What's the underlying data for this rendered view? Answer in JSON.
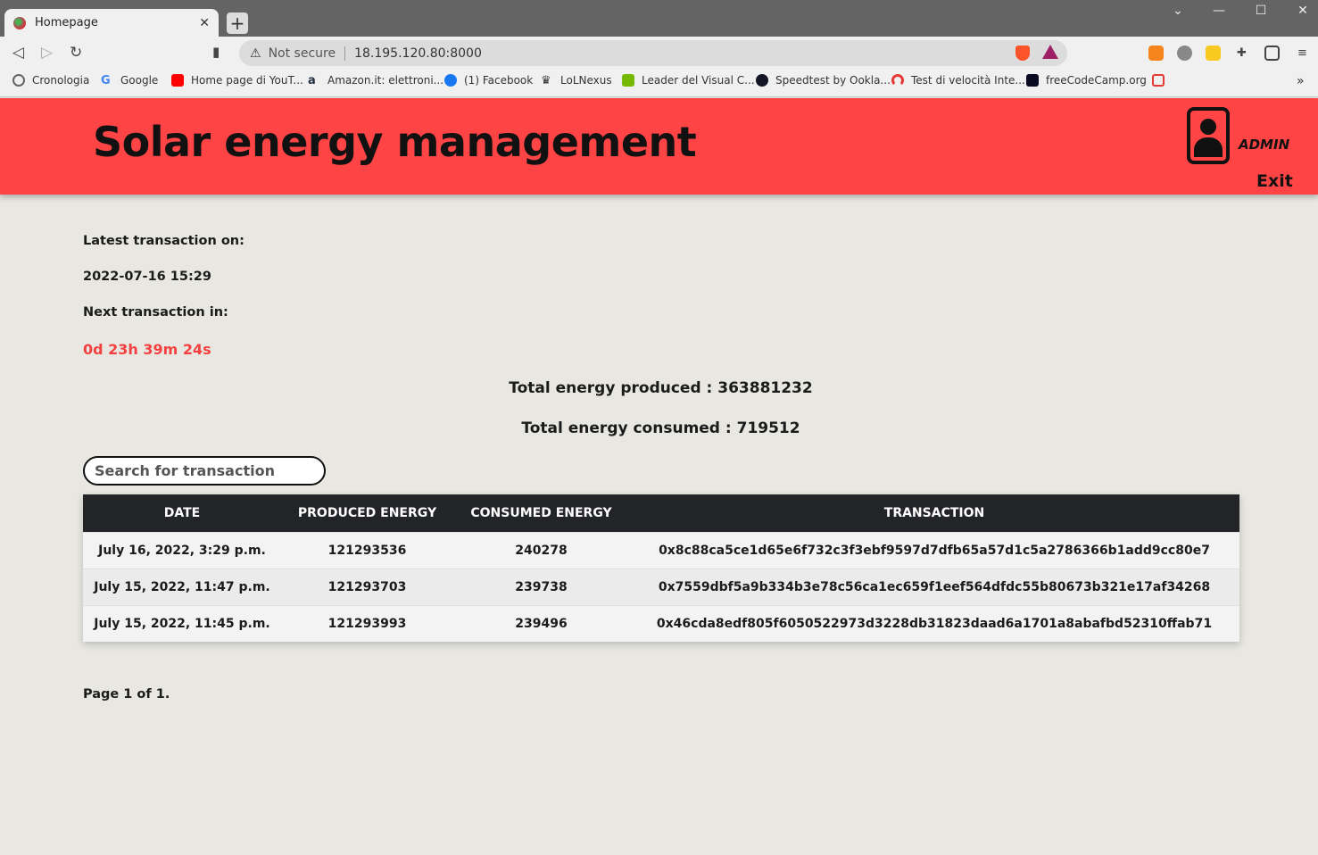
{
  "browser": {
    "tab_title": "Homepage",
    "tab_close": "✕",
    "new_tab": "+",
    "not_secure": "Not secure",
    "url": "18.195.120.80:8000",
    "bookmarks": [
      {
        "label": "Cronologia",
        "color": "#666666"
      },
      {
        "label": "Google",
        "color": "#4285f4"
      },
      {
        "label": "Home page di YouT...",
        "color": "#ff0000"
      },
      {
        "label": "Amazon.it: elettroni...",
        "color": "#232f3e"
      },
      {
        "label": "(1) Facebook",
        "color": "#1877f2"
      },
      {
        "label": "LoLNexus",
        "color": "#333333"
      },
      {
        "label": "Leader del Visual C...",
        "color": "#76b900"
      },
      {
        "label": "Speedtest by Ookla...",
        "color": "#141526"
      },
      {
        "label": "Test di velocità Inte...",
        "color": "#e53935"
      },
      {
        "label": "freeCodeCamp.org",
        "color": "#0a0a23"
      }
    ]
  },
  "header": {
    "title": "Solar energy management",
    "user": "ADMIN",
    "exit": "Exit"
  },
  "info": {
    "latest_label": "Latest transaction on:",
    "latest_value": "2022-07-16 15:29",
    "next_label": "Next transaction in:",
    "countdown": "0d 23h 39m 24s"
  },
  "totals": {
    "produced": "Total energy produced : 363881232",
    "consumed": "Total energy consumed : 719512"
  },
  "search": {
    "placeholder": "Search for transaction"
  },
  "table": {
    "headers": [
      "DATE",
      "PRODUCED ENERGY",
      "CONSUMED ENERGY",
      "TRANSACTION"
    ],
    "rows": [
      [
        "July 16, 2022, 3:29 p.m.",
        "121293536",
        "240278",
        "0x8c88ca5ce1d65e6f732c3f3ebf9597d7dfb65a57d1c5a2786366b1add9cc80e7"
      ],
      [
        "July 15, 2022, 11:47 p.m.",
        "121293703",
        "239738",
        "0x7559dbf5a9b334b3e78c56ca1ec659f1eef564dfdc55b80673b321e17af34268"
      ],
      [
        "July 15, 2022, 11:45 p.m.",
        "121293993",
        "239496",
        "0x46cda8edf805f6050522973d3228db31823daad6a1701a8abafbd52310ffab71"
      ]
    ]
  },
  "pager": "Page 1 of 1.",
  "colors": {
    "header_bg": "#fe4444",
    "countdown": "#f44040",
    "table_header": "#222428",
    "page_bg": "#e8e7e1"
  }
}
